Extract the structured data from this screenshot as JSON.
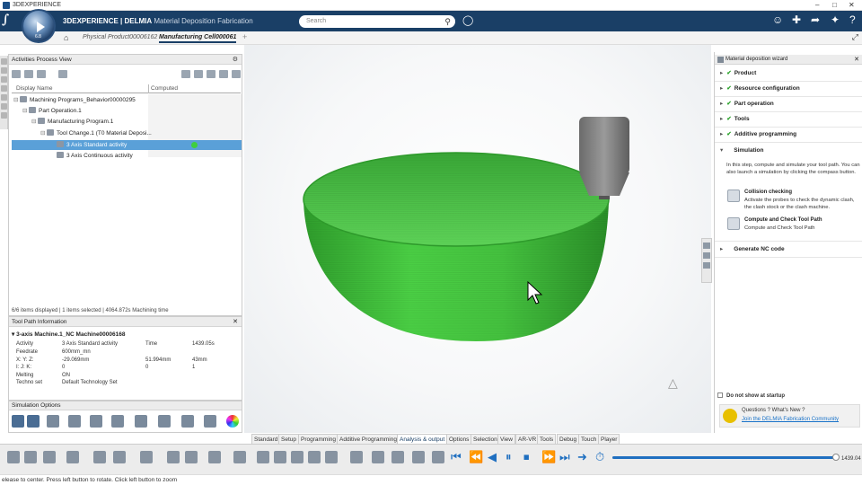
{
  "window": {
    "title": "3DEXPERIENCE"
  },
  "appbar": {
    "compass_version": "6.8",
    "brand_prefix": "3D",
    "brand_main": "EXPERIENCE | DELMIA",
    "brand_app": "Material Deposition Fabrication",
    "search_placeholder": "Search"
  },
  "tabs": {
    "product": "Physical Product00006162",
    "cell": "Manufacturing Cell000061"
  },
  "activities": {
    "title": "Activities Process View",
    "col_display": "Display Name",
    "col_computed": "Computed",
    "tree": [
      "Machining Programs_Behavior00000295",
      "Part Operation.1",
      "Manufacturing Program.1",
      "Tool Change.1 (T0 Material Deposi...",
      "3 Axis Standard activity",
      "3 Axis Continuous activity"
    ],
    "status": "6/6 items displayed | 1 items selected | 4064.872s Machining time"
  },
  "toolpath": {
    "title": "Tool Path Information",
    "machine": "3-axis Machine.1_NC Machine00006168",
    "rows": [
      {
        "label": "Activity",
        "value": "3 Axis Standard activity",
        "extra_label": "Time",
        "extra_value": "1439.05s"
      },
      {
        "label": "Feedrate",
        "value": "600mm_mn"
      },
      {
        "label": "X: Y: Z:",
        "value": "-29.069mm",
        "v2": "51.994mm",
        "v3": "43mm"
      },
      {
        "label": "I: J: K:",
        "value": "0",
        "v2": "0",
        "v3": "1"
      },
      {
        "label": "Melting",
        "value": "ON"
      },
      {
        "label": "Techno set",
        "value": "Default Technology Set"
      }
    ]
  },
  "simulation_options": {
    "title": "Simulation Options"
  },
  "wizard": {
    "title": "Material deposition wizard",
    "steps": [
      "Product",
      "Resource configuration",
      "Part operation",
      "Tools",
      "Additive programming",
      "Simulation",
      "Generate NC code"
    ],
    "sim_text": "In this step, compute and simulate your tool path. You can also launch a simulation by clicking the compass button.",
    "collision_title": "Collision checking",
    "collision_desc": "Activate the probes to check the dynamic clash, the clash stock or the clash machine.",
    "compute_title": "Compute and Check Tool Path",
    "compute_desc": "Compute and Check Tool Path",
    "dont_show": "Do not show at startup",
    "questions": "Questions ? What's New ?",
    "join_link": "Join the DELMIA Fabrication Community"
  },
  "command_tabs": [
    "Standard",
    "Setup",
    "Programming",
    "Additive Programming",
    "Analysis & output",
    "Options",
    "Selection",
    "View",
    "AR-VR",
    "Tools",
    "Debug",
    "Touch",
    "Player"
  ],
  "player": {
    "time": "1439.04",
    "progress": 1.0
  },
  "statusbar": {
    "text": "elease to center. Press left button to rotate. Click left button to zoom"
  },
  "colors": {
    "accent": "#1a3f66",
    "selection": "#5aa0d8",
    "part": "#3dbb3a",
    "check": "#2ba32b"
  }
}
